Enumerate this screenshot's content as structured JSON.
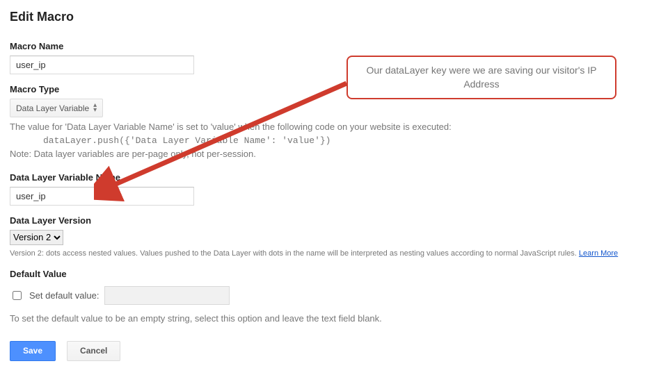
{
  "page": {
    "title": "Edit Macro"
  },
  "macroName": {
    "label": "Macro Name",
    "value": "user_ip"
  },
  "macroType": {
    "label": "Macro Type",
    "selected": "Data Layer Variable",
    "helpLine1": "The value for 'Data Layer Variable Name' is set to 'value' when the following code on your website is executed:",
    "helpCode": "dataLayer.push({'Data Layer Variable Name': 'value'})",
    "helpLine2": "Note: Data layer variables are per-page only, not per-session."
  },
  "varName": {
    "label": "Data Layer Variable Name",
    "value": "user_ip"
  },
  "version": {
    "label": "Data Layer Version",
    "selected": "Version 2",
    "help": "Version 2: dots access nested values. Values pushed to the Data Layer with dots in the name will be interpreted as nesting values according to normal JavaScript rules.",
    "learnMore": "Learn More"
  },
  "defaultValue": {
    "label": "Default Value",
    "checkboxLabel": "Set default value:",
    "help": "To set the default value to be an empty string, select this option and leave the text field blank."
  },
  "buttons": {
    "save": "Save",
    "cancel": "Cancel"
  },
  "callout": {
    "text": "Our dataLayer key were we are saving our visitor's IP Address"
  }
}
